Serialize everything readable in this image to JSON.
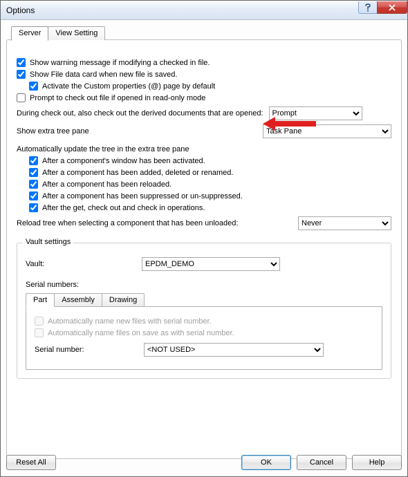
{
  "window": {
    "title": "Options"
  },
  "tabs": {
    "server": "Server",
    "view": "View Setting"
  },
  "checks": {
    "warn_modify": "Show warning message if modifying a checked in file.",
    "show_data_card": "Show File data card when new file is saved.",
    "activate_custom": "Activate the Custom properties (@) page by default",
    "prompt_checkout": "Prompt to check out file if opened in read-only mode"
  },
  "derived_label": "During check out, also check out the derived documents that are opened:",
  "derived_value": "Prompt",
  "tree_pane_label": "Show extra tree pane",
  "tree_pane_value": "Task Pane",
  "auto_title": "Automatically update the tree in the extra tree pane",
  "auto": {
    "win_activated": "After a component's window has been activated.",
    "added_deleted": "After a component has been added, deleted or renamed.",
    "reloaded": "After a component has been reloaded.",
    "suppressed": "After a component has been suppressed or un-suppressed.",
    "get_checkout": "After the get, check out and check in operations."
  },
  "reload_label": "Reload tree when selecting a component that has been unloaded:",
  "reload_value": "Never",
  "vault_group": "Vault settings",
  "vault_label": "Vault:",
  "vault_value": "EPDM_DEMO",
  "serial_group": "Serial numbers:",
  "serial_tabs": {
    "part": "Part",
    "assembly": "Assembly",
    "drawing": "Drawing"
  },
  "serial_auto_new": "Automatically name new files with serial number.",
  "serial_auto_save": "Automatically name files on save as with serial number.",
  "serial_label": "Serial number:",
  "serial_value": "<NOT USED>",
  "buttons": {
    "reset": "Reset All",
    "ok": "OK",
    "cancel": "Cancel",
    "help": "Help"
  }
}
